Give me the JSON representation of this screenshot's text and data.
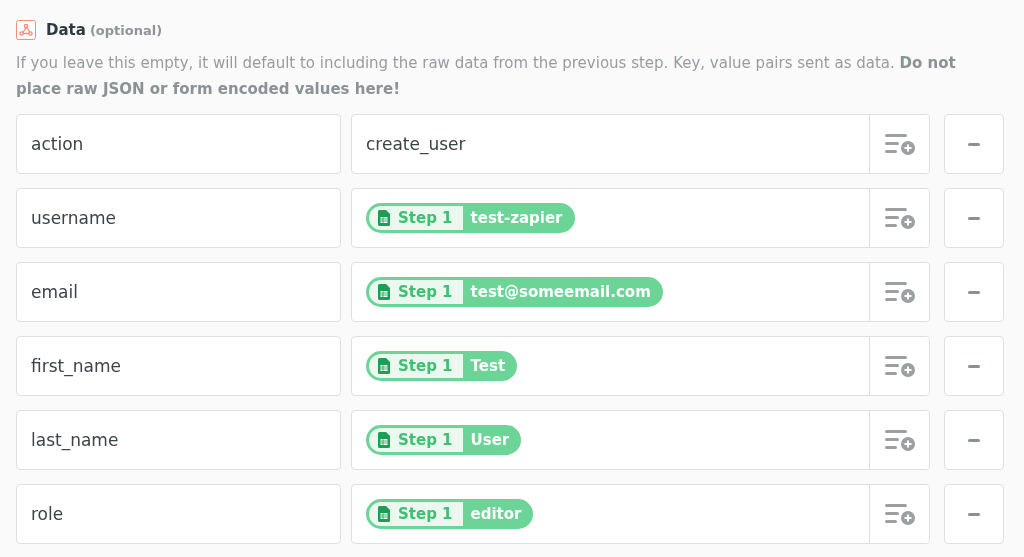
{
  "field": {
    "label": "Data",
    "hint": "(optional)",
    "description": "If you leave this empty, it will default to including the raw data from the previous step. Key, value pairs sent as data. **Do not place raw JSON or form encoded values here!**"
  },
  "rows": [
    {
      "key": "action",
      "value": {
        "kind": "text",
        "text": "create_user"
      }
    },
    {
      "key": "username",
      "value": {
        "kind": "token",
        "step": "Step 1",
        "text": "test-zapier"
      }
    },
    {
      "key": "email",
      "value": {
        "kind": "token",
        "step": "Step 1",
        "text": "test@someemail.com"
      }
    },
    {
      "key": "first_name",
      "value": {
        "kind": "token",
        "step": "Step 1",
        "text": "Test"
      }
    },
    {
      "key": "last_name",
      "value": {
        "kind": "token",
        "step": "Step 1",
        "text": "User"
      }
    },
    {
      "key": "role",
      "value": {
        "kind": "token",
        "step": "Step 1",
        "text": "editor"
      }
    }
  ]
}
